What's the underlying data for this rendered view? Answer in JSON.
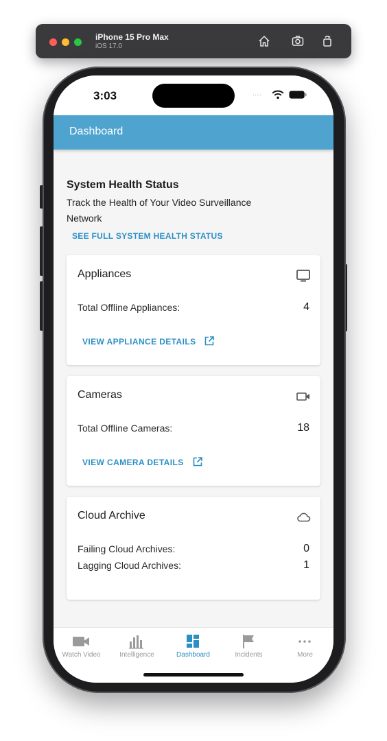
{
  "simulator": {
    "device_name": "iPhone 15 Pro Max",
    "os_version": "iOS 17.0",
    "icons": [
      "home-icon",
      "screenshot-icon",
      "rotate-icon"
    ]
  },
  "status_bar": {
    "time": "3:03",
    "signal": "....",
    "icons": [
      "wifi-icon",
      "battery-icon"
    ]
  },
  "app_bar": {
    "title": "Dashboard"
  },
  "health": {
    "title": "System Health Status",
    "subtitle": "Track the Health of Your Video Surveillance Network",
    "link": "SEE FULL SYSTEM HEALTH STATUS"
  },
  "cards": {
    "appliances": {
      "title": "Appliances",
      "icon": "monitor-icon",
      "label": "Total Offline Appliances:",
      "value": "4",
      "link": "VIEW APPLIANCE DETAILS"
    },
    "cameras": {
      "title": "Cameras",
      "icon": "video-camera-icon",
      "label": "Total Offline Cameras:",
      "value": "18",
      "link": "VIEW CAMERA DETAILS"
    },
    "cloud": {
      "title": "Cloud Archive",
      "icon": "cloud-icon",
      "failing_label": "Failing Cloud Archives:",
      "failing_value": "0",
      "lagging_label": "Lagging Cloud Archives:",
      "lagging_value": "1"
    }
  },
  "bottom_nav": {
    "items": [
      {
        "label": "Watch Video",
        "icon": "video-camera-icon"
      },
      {
        "label": "Intelligence",
        "icon": "bar-chart-icon"
      },
      {
        "label": "Dashboard",
        "icon": "dashboard-icon",
        "active": true
      },
      {
        "label": "Incidents",
        "icon": "flag-icon"
      },
      {
        "label": "More",
        "icon": "more-dots-icon"
      }
    ]
  },
  "colors": {
    "accent": "#2b8fc6",
    "app_bar": "#4ea4cf",
    "background": "#f5f5f5",
    "nav_inactive": "#9a9a9a"
  }
}
